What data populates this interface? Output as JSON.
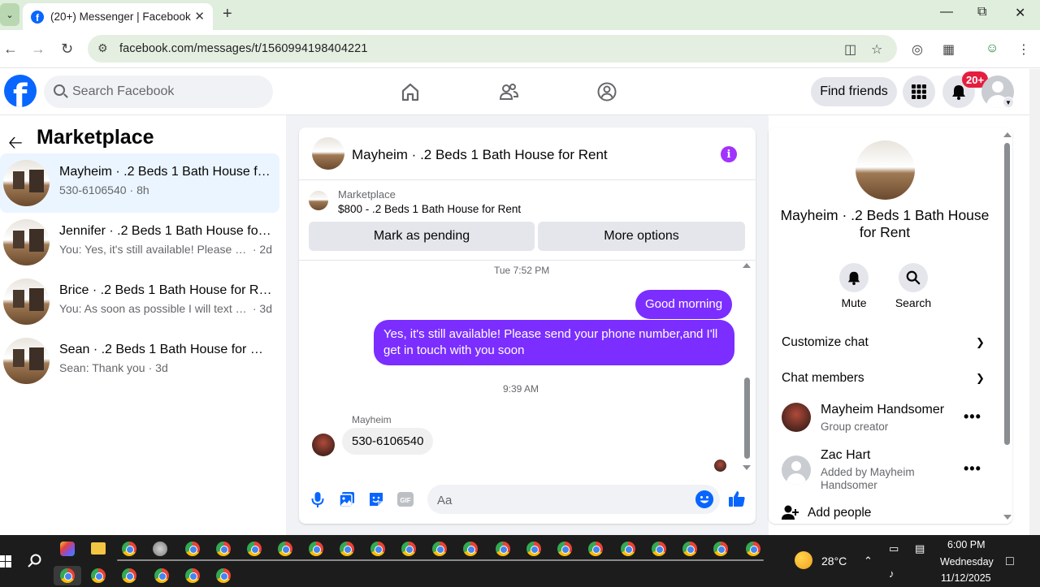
{
  "browser": {
    "tab_title": "(20+) Messenger | Facebook",
    "url": "facebook.com/messages/t/1560994198404221"
  },
  "header": {
    "search_placeholder": "Search Facebook",
    "find_friends": "Find friends",
    "notification_badge": "20+"
  },
  "sidebar": {
    "title": "Marketplace",
    "conversations": [
      {
        "name": "Mayheim · .2 Beds 1 Bath House for Rent",
        "preview": "530-6106540",
        "time": "· 8h",
        "active": true
      },
      {
        "name": "Jennifer · .2 Beds 1 Bath House for Rent",
        "preview": "You: Yes, it's still available! Please send your phone number",
        "time": "· 2d",
        "active": false
      },
      {
        "name": "Brice · .2 Beds 1 Bath House for Rent",
        "preview": "You: As soon as possible I will text you",
        "time": "· 3d",
        "active": false
      },
      {
        "name": "Sean · .2 Beds 1 Bath House for Rent",
        "preview": "Sean: Thank you",
        "time": "· 3d",
        "active": false
      }
    ]
  },
  "chat": {
    "title": "Mayheim · .2 Beds 1 Bath House for Rent",
    "listing_label": "Marketplace",
    "listing_price": "$800 - .2 Beds 1 Bath House for Rent",
    "mark_pending": "Mark as pending",
    "more_options": "More options",
    "timestamp_1": "Tue 7:52 PM",
    "msg_out_1": "Good morning",
    "msg_out_2": "Yes, it's still available! Please send your phone number,and I'll get in touch with you soon",
    "timestamp_2": "9:39 AM",
    "sender_name": "Mayheim",
    "msg_in_1": "530-6106540",
    "composer_placeholder": "Aa",
    "accent_color": "#7b2eff"
  },
  "details": {
    "name": "Mayheim · .2 Beds 1 Bath House for Rent",
    "mute": "Mute",
    "search": "Search",
    "customize_chat": "Customize chat",
    "chat_members": "Chat members",
    "members": [
      {
        "name": "Mayheim Handsomer",
        "role": "Group creator"
      },
      {
        "name": "Zac Hart",
        "role": "Added by Mayheim Handsomer"
      }
    ],
    "add_people": "Add people"
  },
  "taskbar": {
    "temperature": "28°C",
    "time": "6:00 PM",
    "day": "Wednesday",
    "date": "11/12/2025"
  }
}
